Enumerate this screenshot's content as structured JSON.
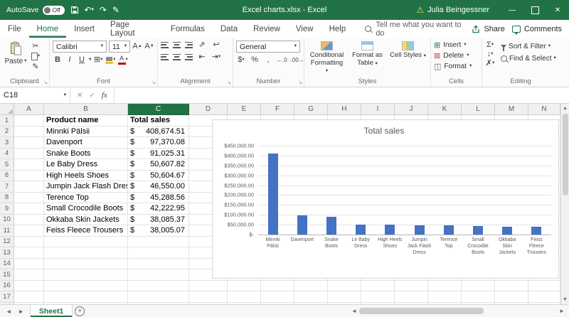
{
  "colors": {
    "title_bar_green": "#217346",
    "accent_green": "#217346",
    "selected_column_header": "#217346",
    "chart_bar_blue": "#4472c4"
  },
  "title_bar": {
    "autosave_label": "AutoSave",
    "autosave_state": "Off",
    "window_title": "Excel charts.xlsx - Excel",
    "user_name": "Julia Beingessner"
  },
  "ribbon_tabs": {
    "tabs": [
      "File",
      "Home",
      "Insert",
      "Page Layout",
      "Formulas",
      "Data",
      "Review",
      "View",
      "Help"
    ],
    "active": "Home",
    "search_placeholder": "Tell me what you want to do",
    "share": "Share",
    "comments": "Comments"
  },
  "ribbon": {
    "clipboard": {
      "label": "Clipboard",
      "paste": "Paste"
    },
    "font": {
      "label": "Font",
      "name": "Calibri",
      "size": "11",
      "bold": "B",
      "italic": "I",
      "underline": "U"
    },
    "alignment": {
      "label": "Alignment"
    },
    "number": {
      "label": "Number",
      "format": "General",
      "currency": "$",
      "percent": "%",
      "comma": ",",
      "inc_decimal": "←.0",
      "dec_decimal": ".00→"
    },
    "styles": {
      "label": "Styles",
      "conditional": "Conditional Formatting",
      "format_table": "Format as Table",
      "cell_styles": "Cell Styles"
    },
    "cells": {
      "label": "Cells",
      "insert": "Insert",
      "delete": "Delete",
      "format": "Format"
    },
    "editing": {
      "label": "Editing",
      "sort": "Sort & Filter",
      "find": "Find & Select"
    }
  },
  "formula_bar": {
    "name_box": "C18",
    "fx": "fx",
    "formula": ""
  },
  "sheet": {
    "columns": [
      "A",
      "B",
      "C",
      "D",
      "E",
      "F",
      "G",
      "H",
      "I",
      "J",
      "K",
      "L",
      "M",
      "N"
    ],
    "selected_column": "C",
    "visible_rows": 18,
    "headers": {
      "b": "Product name",
      "c": "Total sales"
    },
    "rows": [
      {
        "product": "Minnki Pälsii",
        "currency": "$",
        "amount": "408,674.51"
      },
      {
        "product": "Davenport",
        "currency": "$",
        "amount": "97,370.08"
      },
      {
        "product": "Snake Boots",
        "currency": "$",
        "amount": "91,025.31"
      },
      {
        "product": "Le Baby Dress",
        "currency": "$",
        "amount": "50,607.82"
      },
      {
        "product": "High Heels Shoes",
        "currency": "$",
        "amount": "50,604.67"
      },
      {
        "product": "Jumpin Jack Flash Dress",
        "currency": "$",
        "amount": "46,550.00"
      },
      {
        "product": "Terence Top",
        "currency": "$",
        "amount": "45,288.56"
      },
      {
        "product": "Small Crocodile Boots",
        "currency": "$",
        "amount": "42,222.95"
      },
      {
        "product": "Okkaba Skin Jackets",
        "currency": "$",
        "amount": "38,085.37"
      },
      {
        "product": "Feiss Fleece Trousers",
        "currency": "$",
        "amount": "38,005.07"
      }
    ]
  },
  "chart_data": {
    "type": "bar",
    "title": "Total sales",
    "xlabel": "",
    "ylabel": "",
    "categories": [
      "Minnki Pälsii",
      "Davenport",
      "Snake Boots",
      "Le Baby Dress",
      "High Heels Shoes",
      "Jumpin Jack Flash Dress",
      "Terence Top",
      "Small Crocodile Boots",
      "Okkaba Skin Jackets",
      "Feiss Fleece Trousers"
    ],
    "values": [
      408674.51,
      97370.08,
      91025.31,
      50607.82,
      50604.67,
      46550.0,
      45288.56,
      42222.95,
      38085.37,
      38005.07
    ],
    "ylim": [
      0,
      450000
    ],
    "y_ticks": [
      "$450,000.00",
      "$400,000.00",
      "$350,000.00",
      "$300,000.00",
      "$250,000.00",
      "$200,000.00",
      "$150,000.00",
      "$100,000.00",
      "$50,000.00",
      "$-"
    ],
    "grid": true,
    "legend": "none",
    "bar_color": "#4472c4"
  },
  "sheet_tabs": {
    "active": "Sheet1"
  }
}
